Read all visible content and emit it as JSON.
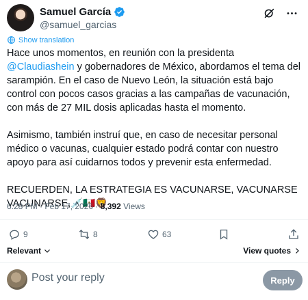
{
  "author": {
    "display_name": "Samuel García",
    "handle": "@samuel_garcias"
  },
  "translation_link": "Show translation",
  "tweet": {
    "paragraph1_before": "Hace unos momentos, en reunión con la presidenta ",
    "mention": "@Claudiashein",
    "paragraph1_after": " y gobernadores de México, abordamos el tema del sarampión. En el caso de Nuevo León, la situación está bajo control con pocos casos gracias a las campañas de vacunación, con más de 27 MIL dosis aplicadas hasta el momento.",
    "paragraph2": "Asimismo, también instruí que, en caso de necesitar personal médico o vacunas, cualquier estado podrá contar con nuestro apoyo para así cuidarnos todos y prevenir esta enfermedad.",
    "paragraph3": "RECUERDEN, LA ESTRATEGIA ES VACUNARSE, VACUNARSE VACUNARSE,💉🇲🇽🦁"
  },
  "meta": {
    "time": "6:28 PM · Feb 17, 2026 · ",
    "views_count": "8,392",
    "views_label": " Views"
  },
  "actions": {
    "replies": "9",
    "reposts": "8",
    "likes": "63"
  },
  "sort": {
    "relevant": "Relevant",
    "view_quotes": "View quotes"
  },
  "reply": {
    "placeholder": "Post your reply",
    "button": "Reply"
  },
  "colors": {
    "accent": "#1d9bf0",
    "text": "#0f1419",
    "muted": "#536471",
    "reply_button": "#8b98a5"
  },
  "icons": [
    "verified-badge-icon",
    "grok-icon",
    "more-icon",
    "translate-icon",
    "reply-icon",
    "repost-icon",
    "like-icon",
    "bookmark-icon",
    "share-icon",
    "chevron-down-icon",
    "chevron-right-icon"
  ]
}
